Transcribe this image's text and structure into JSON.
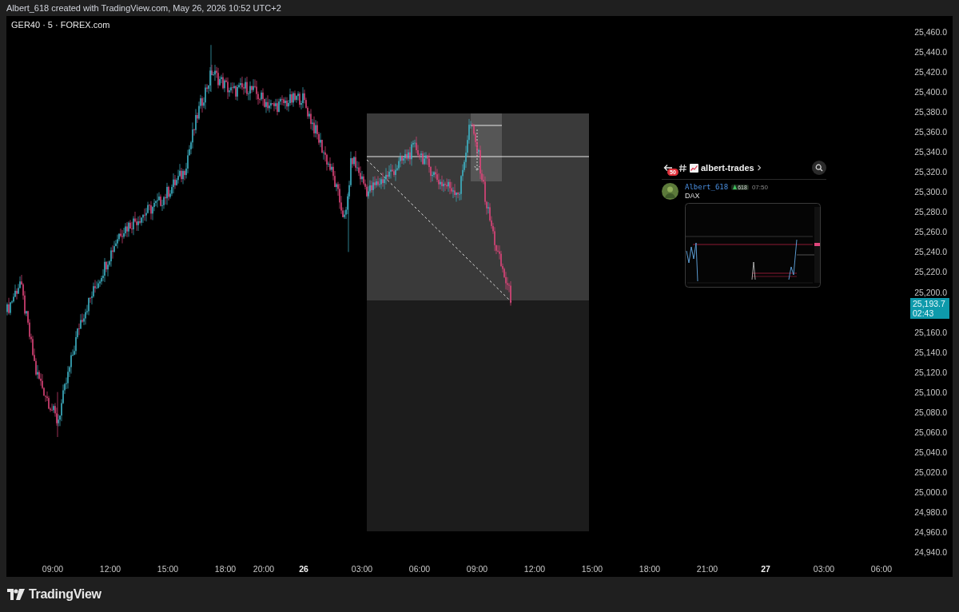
{
  "header": {
    "text": "Albert_618 created with TradingView.com, May 26, 2026 10:52 UTC+2"
  },
  "chart": {
    "symbol": "GER40 · 5 · FOREX.com",
    "price_axis": [
      "25,460.0",
      "25,440.0",
      "25,420.0",
      "25,400.0",
      "25,380.0",
      "25,360.0",
      "25,340.0",
      "25,320.0",
      "25,300.0",
      "25,280.0",
      "25,260.0",
      "25,240.0",
      "25,220.0",
      "25,200.0",
      "25,160.0",
      "25,140.0",
      "25,120.0",
      "25,100.0",
      "25,080.0",
      "25,060.0",
      "25,040.0",
      "25,020.0",
      "25,000.0",
      "24,980.0",
      "24,960.0",
      "24,940.0"
    ],
    "current_price": {
      "price": "25,193.7",
      "countdown": "02:43"
    },
    "time_axis": [
      {
        "label": "09:00",
        "kind": "time"
      },
      {
        "label": "12:00",
        "kind": "time"
      },
      {
        "label": "15:00",
        "kind": "time"
      },
      {
        "label": "18:00",
        "kind": "time"
      },
      {
        "label": "20:00",
        "kind": "time"
      },
      {
        "label": "26",
        "kind": "day"
      },
      {
        "label": "03:00",
        "kind": "time"
      },
      {
        "label": "06:00",
        "kind": "time"
      },
      {
        "label": "09:00",
        "kind": "time"
      },
      {
        "label": "12:00",
        "kind": "time"
      },
      {
        "label": "15:00",
        "kind": "time"
      },
      {
        "label": "18:00",
        "kind": "time"
      },
      {
        "label": "21:00",
        "kind": "time"
      },
      {
        "label": "27",
        "kind": "day"
      },
      {
        "label": "03:00",
        "kind": "time"
      },
      {
        "label": "06:00",
        "kind": "time"
      }
    ]
  },
  "embedded_post": {
    "unread_count": "50",
    "channel": "albert-trades",
    "author": "Albert_618",
    "role_badge": "618",
    "time": "07:50",
    "message": "DAX"
  },
  "footer": {
    "brand": "TradingView"
  }
}
